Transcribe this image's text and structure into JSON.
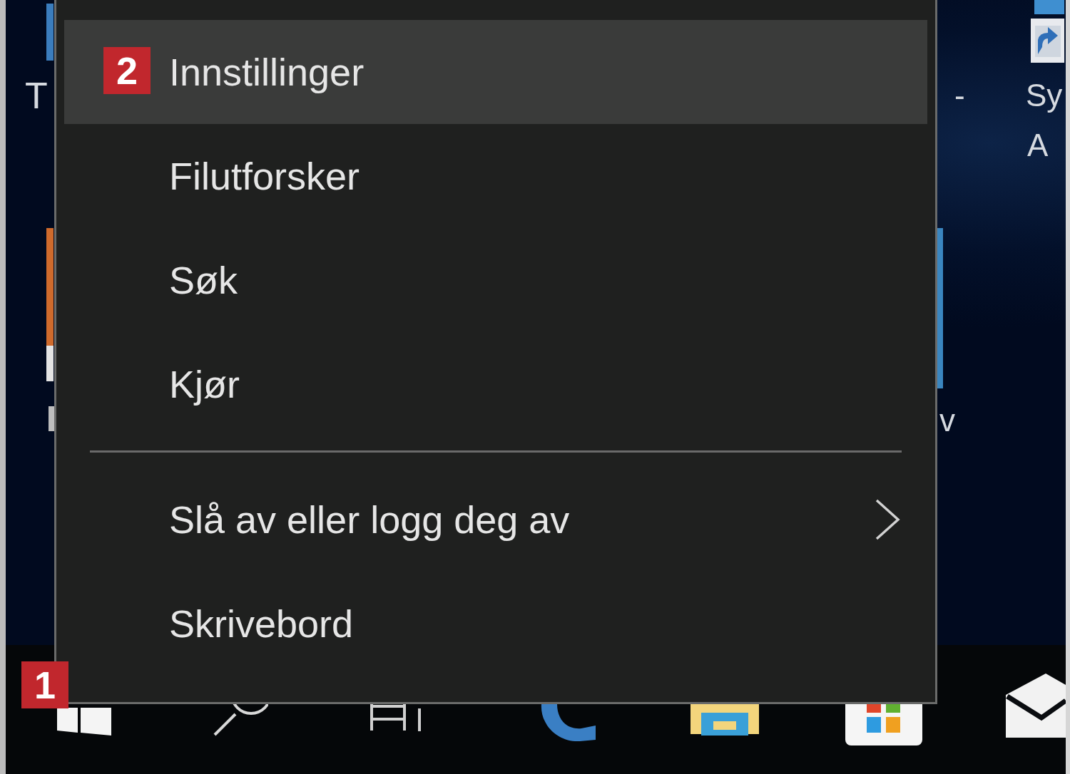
{
  "desktop": {
    "labels": [
      {
        "text": "T"
      },
      {
        "text": "-"
      },
      {
        "text": "v"
      },
      {
        "text": "Sy"
      },
      {
        "text": "A"
      }
    ]
  },
  "context_menu": {
    "items": [
      {
        "kind": "item",
        "label": "Innstillinger",
        "selected": true,
        "submenu": false,
        "callout": "2"
      },
      {
        "kind": "item",
        "label": "Filutforsker",
        "selected": false,
        "submenu": false
      },
      {
        "kind": "item",
        "label": "Søk",
        "selected": false,
        "submenu": false
      },
      {
        "kind": "item",
        "label": "Kjør",
        "selected": false,
        "submenu": false
      },
      {
        "kind": "separator"
      },
      {
        "kind": "item",
        "label": "Slå av eller logg deg av",
        "selected": false,
        "submenu": true
      },
      {
        "kind": "item",
        "label": "Skrivebord",
        "selected": false,
        "submenu": false
      }
    ]
  },
  "taskbar": {
    "buttons": [
      {
        "kind": "start",
        "callout": "1"
      },
      {
        "kind": "search"
      },
      {
        "kind": "task_view"
      },
      {
        "kind": "browser"
      },
      {
        "kind": "file_explorer"
      },
      {
        "kind": "store"
      },
      {
        "kind": "mail"
      }
    ]
  }
}
